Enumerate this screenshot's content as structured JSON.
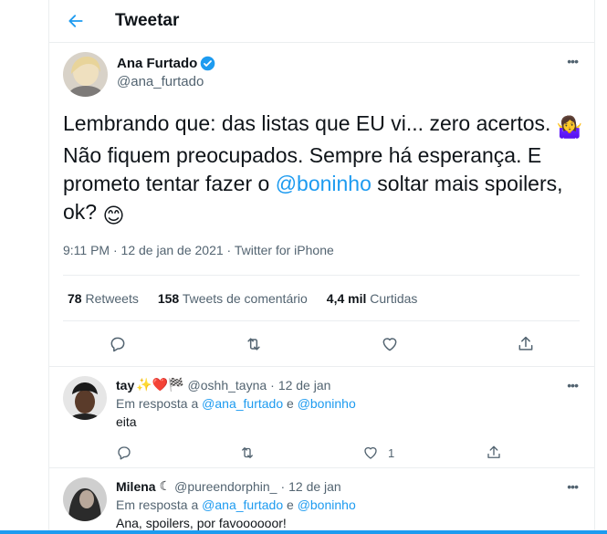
{
  "header": {
    "title": "Tweetar"
  },
  "main_tweet": {
    "author_name": "Ana Furtado",
    "author_handle": "@ana_furtado",
    "text_before": "Lembrando que: das listas que EU vi... zero acertos. ",
    "emoji_1": "🤷‍♀️",
    "text_middle_1": " Não fiquem preocupados. Sempre há esperança. E prometo tentar fazer o ",
    "mention": "@boninho",
    "text_middle_2": " soltar mais spoilers, ok? ",
    "emoji_2": "😊",
    "meta": "9:11 PM · 12 de jan de 2021 · Twitter for iPhone",
    "retweets_count": "78",
    "retweets_label": "Retweets",
    "comments_count": "158",
    "comments_label": "Tweets de comentário",
    "likes_count": "4,4 mil",
    "likes_label": "Curtidas",
    "more_glyph": "•••"
  },
  "replies": [
    {
      "name": "tay",
      "name_emojis": "✨❤️🏁",
      "handle": "@oshh_tayna",
      "dot": "·",
      "date": "12 de jan",
      "reply_prefix": "Em resposta a",
      "reply_mention_1": "@ana_furtado",
      "reply_conjunction": "e",
      "reply_mention_2": "@boninho",
      "text": "eita",
      "like_count": "1",
      "more_glyph": "•••"
    },
    {
      "name": "Milena",
      "name_emojis": "☾",
      "handle": "@pureendorphin_",
      "dot": "·",
      "date": "12 de jan",
      "reply_prefix": "Em resposta a",
      "reply_mention_1": "@ana_furtado",
      "reply_conjunction": "e",
      "reply_mention_2": "@boninho",
      "text": "Ana, spoilers, por favoooooor!",
      "more_glyph": "•••"
    }
  ],
  "colors": {
    "accent": "#1d9bf0",
    "secondary_text": "#536471",
    "border": "#ebeef0"
  },
  "icons": [
    "back-arrow-icon",
    "verified-badge-icon",
    "reply-icon",
    "retweet-icon",
    "like-icon",
    "share-icon",
    "more-icon"
  ]
}
